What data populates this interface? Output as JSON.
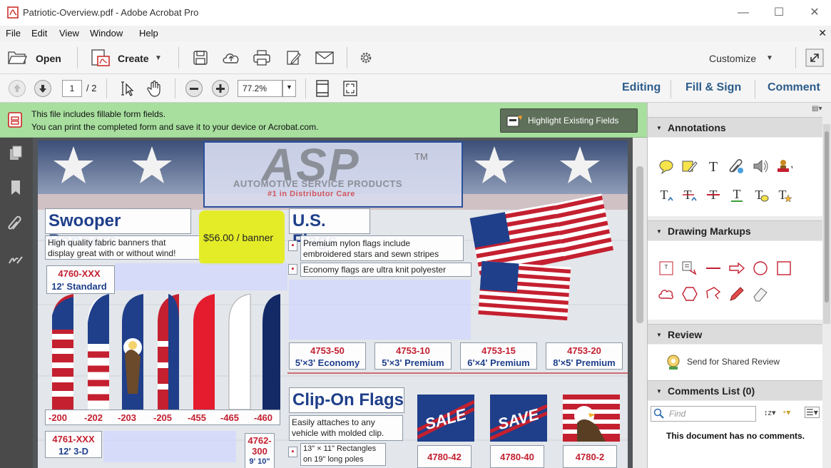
{
  "window": {
    "title": "Patriotic-Overview.pdf - Adobe Acrobat Pro"
  },
  "menu": [
    "File",
    "Edit",
    "View",
    "Window",
    "Help"
  ],
  "toolbar": {
    "open_label": "Open",
    "create_label": "Create",
    "customize_label": "Customize"
  },
  "nav": {
    "page_current": "1",
    "page_total": "/ 2",
    "zoom": "77.2%",
    "editing_label": "Editing",
    "fill_sign_label": "Fill & Sign",
    "comment_label": "Comment"
  },
  "notice": {
    "line1": "This file includes fillable form fields.",
    "line2": "You can print the completed form and save it to your device or Acrobat.com.",
    "button_label": "Highlight Existing Fields"
  },
  "panel": {
    "annotations_title": "Annotations",
    "drawing_title": "Drawing Markups",
    "review_title": "Review",
    "send_review_label": "Send for Shared Review",
    "comments_title": "Comments List (0)",
    "find_placeholder": "Find",
    "no_comments": "This document has no comments."
  },
  "document": {
    "logo_text": "ASP",
    "logo_tm": "TM",
    "logo_subtitle": "AUTOMOTIVE SERVICE PRODUCTS",
    "logo_tagline": "#1 in Distributor Care",
    "swooper_title": "Swooper Banners",
    "swooper_desc1": "High quality fabric banners that",
    "swooper_desc2": "display great with or without wind!",
    "price_highlight": "$56.00 / banner",
    "swooper_code": "4760-XXX",
    "swooper_size": "12' Standard",
    "swooper_variants": [
      "-200",
      "-202",
      "-203",
      "-205",
      "-455",
      "-465",
      "-460"
    ],
    "swooper3d_code": "4761-XXX",
    "swooper3d_size": "12' 3-D",
    "code_4762": "4762-",
    "code_4762b": "300",
    "size_4762": "9' 10\"",
    "usflags_title": "U.S. Flags",
    "usflags_bullet1a": "Premium nylon flags include",
    "usflags_bullet1b": "embroidered stars and sewn stripes",
    "usflags_bullet2": "Economy flags are ultra knit polyester",
    "usflags_products": [
      {
        "code": "4753-50",
        "size": "5'×3'",
        "grade": "Economy"
      },
      {
        "code": "4753-10",
        "size": "5'×3'",
        "grade": "Premium"
      },
      {
        "code": "4753-15",
        "size": "6'×4'",
        "grade": "Premium"
      },
      {
        "code": "4753-20",
        "size": "8'×5'",
        "grade": "Premium"
      }
    ],
    "clipon_title": "Clip-On Flags",
    "clipon_desc1": "Easily attaches to any",
    "clipon_desc2": "vehicle with molded clip.",
    "clipon_bullet1a": "13\" × 11\" Rectangles",
    "clipon_bullet1b": "on 19\" long poles",
    "clipon_codes": [
      "4780-42",
      "4780-40",
      "4780-2"
    ],
    "sale_text": "SALE",
    "save_text": "SAVE"
  }
}
